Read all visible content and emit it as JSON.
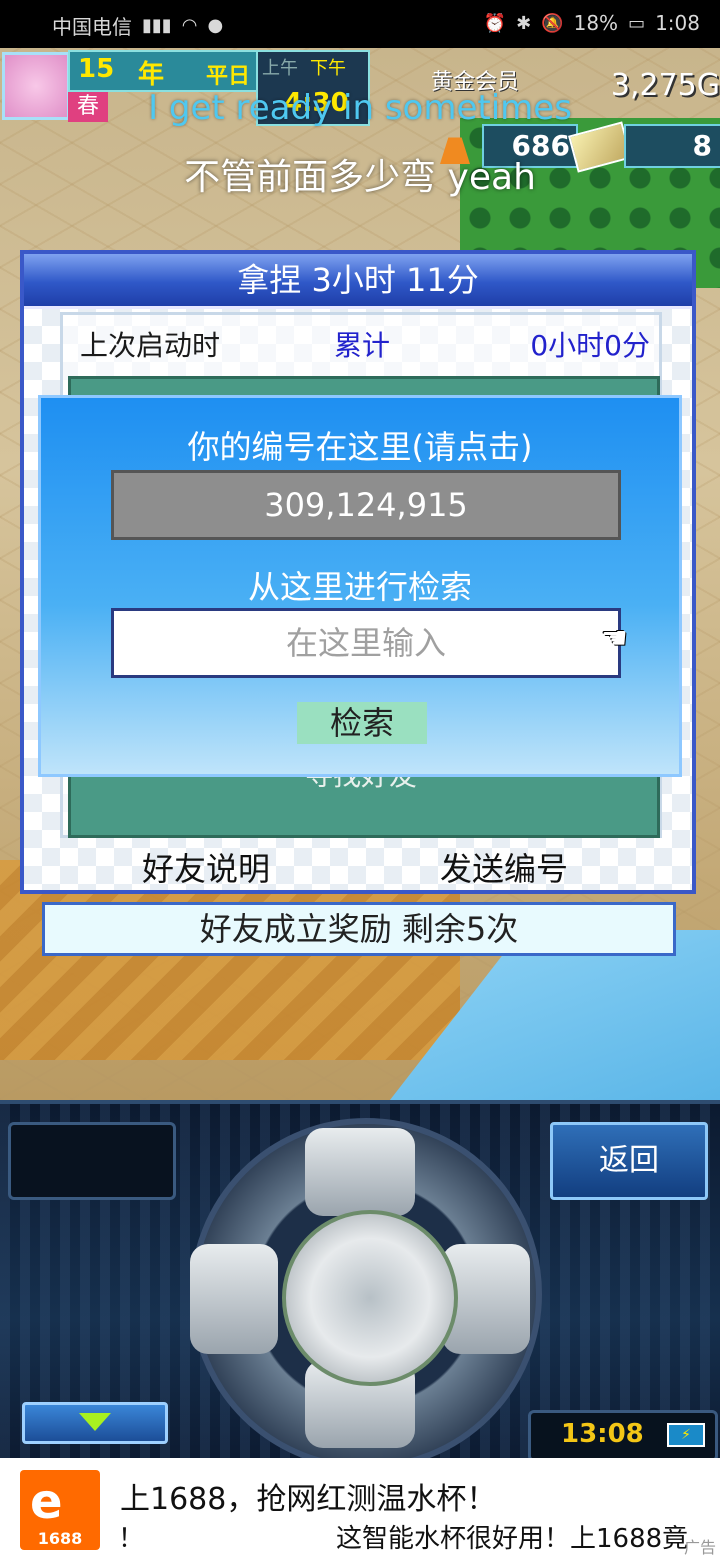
{
  "status_bar": {
    "carrier": "中国电信",
    "battery": "18%",
    "time": "1:08"
  },
  "hud": {
    "year": "15",
    "year_unit": "年",
    "day_type": "平日",
    "season": "春",
    "time_morning": "上午",
    "time_afternoon": "下午",
    "clock": "4:30",
    "rank": "黄金会员",
    "money": "3,275G",
    "research_points": "686",
    "tickets": "8"
  },
  "lyrics": {
    "line1": "I get ready in sometimes",
    "line2": "不管前面多少弯 yeah"
  },
  "panel": {
    "title": "拿捏  3小时 11分",
    "last_launch_label": "上次启动时",
    "total_label": "累计",
    "total_value": "0小时0分",
    "find_friend": "寻找好友",
    "friend_help": "好友说明",
    "send_id": "发送编号",
    "reward": "好友成立奖励  剩余5次"
  },
  "dialog": {
    "title": "你的编号在这里(请点击)",
    "id_value": "309,124,915",
    "search_label": "从这里进行检索",
    "search_placeholder": "在这里输入",
    "search_button": "检索"
  },
  "controller": {
    "back_button": "返回",
    "game_clock": "13:08"
  },
  "ad": {
    "logo_text": "1688",
    "line1": "上1688，抢网红测温水杯！",
    "line2a": "！",
    "line2b": "这智能水杯很好用！上1688竟",
    "tag": "广告"
  }
}
